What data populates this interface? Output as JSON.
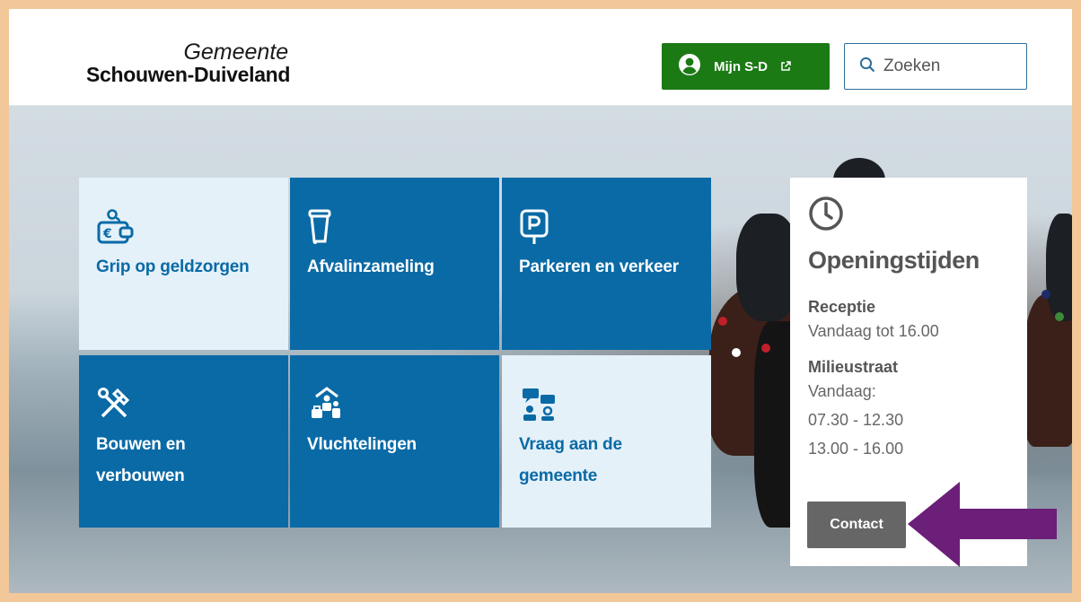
{
  "header": {
    "logo_line1": "Gemeente",
    "logo_line2": "Schouwen-Duiveland",
    "mijn_label": "Mijn S-D",
    "search_placeholder": "Zoeken"
  },
  "tiles": [
    {
      "label": "Grip op geldzorgen",
      "icon": "wallet-euro-icon"
    },
    {
      "label": "Afvalinzameling",
      "icon": "trash-bin-icon"
    },
    {
      "label": "Parkeren en verkeer",
      "icon": "parking-sign-icon"
    },
    {
      "label_line1": "Bouwen en",
      "label_line2": "verbouwen",
      "icon": "hammer-wrench-icon"
    },
    {
      "label": "Vluchtelingen",
      "icon": "refugee-family-icon"
    },
    {
      "label_line1": "Vraag aan de",
      "label_line2": "gemeente",
      "icon": "chat-people-icon"
    }
  ],
  "opening": {
    "title": "Openingstijden",
    "reception_label": "Receptie",
    "reception_time": "Vandaag tot 16.00",
    "milieu_label": "Milieustraat",
    "milieu_today": "Vandaag:",
    "milieu_time1": "07.30 - 12.30",
    "milieu_time2": "13.00 - 16.00",
    "contact_label": "Contact"
  },
  "colors": {
    "brand_blue": "#0a6aa6",
    "light_tile": "#e5f1f9",
    "green_button": "#1b7a14",
    "contact_button": "#666666",
    "annotation_arrow": "#6b1f78",
    "frame": "#f2c79a"
  }
}
